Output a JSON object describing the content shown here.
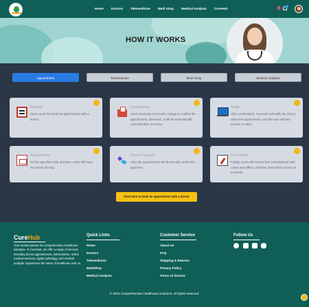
{
  "nav": {
    "links": [
      "Home",
      "Doctors",
      "Telemedicine",
      "Medi Shop",
      "Medical Analysis",
      "CureHub"
    ]
  },
  "hero": {
    "title": "HOW IT WORKS"
  },
  "tabs": [
    {
      "label": "Appointment",
      "active": true
    },
    {
      "label": "Telemedicine",
      "active": false
    },
    {
      "label": "Medi Shop",
      "active": false
    },
    {
      "label": "Medical Analysis",
      "active": false
    }
  ],
  "cards": [
    {
      "title": "Booking",
      "desc": "Users must first book an appointment with a doctor.",
      "icon": "desk-icon"
    },
    {
      "title": "Confirmation",
      "desc": "Users must pay CureHub's charge to confirm the appointment; otherwise, it will be automatically canceled after one hour.",
      "icon": "hospital-icon"
    },
    {
      "title": "Notify",
      "desc": "After confirmation, CureHub will notify the doctor about the appointment, and the user will also receive a notice.",
      "icon": "laptop-icon"
    },
    {
      "title": "Appointment",
      "desc": "On the specified date and time, users will meet the doctor directly.",
      "icon": "calendar-icon"
    },
    {
      "title": "Doctor Payment",
      "desc": "After the appointment, the doctor will confirm the payment.",
      "icon": "payment-icon"
    },
    {
      "title": "Prescription",
      "desc": "Finally, users will receive their prescriptions both online and offline, and their data will be stored on CureHub.",
      "icon": "prescription-icon"
    }
  ],
  "cta": {
    "label": "Click here to book an appointment with a doctor"
  },
  "footer": {
    "brand_a": "Cure",
    "brand_b": "Hub",
    "desc": "Your trusted partner for comprehensive healthcare solutions. At CureHub, we offer a range of services including doctor appointments, telemedicine, online medical services, digital pathology, and medical analysis. Experience the future of healthcare with us.",
    "quick_title": "Quick Links",
    "quick_links": [
      "Home",
      "Doctors",
      "Telemedicine",
      "MediShop",
      "Medical Analysis"
    ],
    "service_title": "Customer Service",
    "service_links": [
      "About Us",
      "FAQ",
      "Shipping & Returns",
      "Privacy Policy",
      "Terms of Service"
    ],
    "follow_title": "Follow Us",
    "socials": [
      "facebook-icon",
      "linkedin-icon",
      "instagram-icon",
      "youtube-icon"
    ],
    "copyright": "© 2024 Comprehensive healthcare solutions. All rights reserved."
  },
  "colors": {
    "nav_bg": "#0f5f57",
    "accent_blue": "#2b7be4",
    "accent_yellow": "#f2b711",
    "page_bg": "#2b3747"
  }
}
